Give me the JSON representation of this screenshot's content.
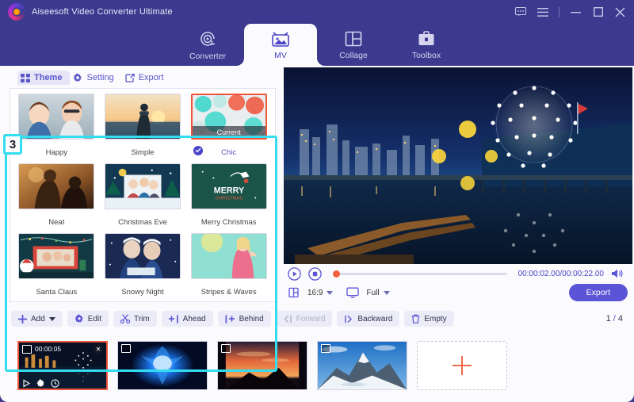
{
  "titlebar": {
    "app_title": "Aiseesoft Video Converter Ultimate",
    "controls": [
      {
        "name": "feedback-icon",
        "label": "Feedback"
      },
      {
        "name": "menu-icon",
        "label": "Menu"
      },
      {
        "name": "minimize-icon",
        "label": "Minimize"
      },
      {
        "name": "maximize-icon",
        "label": "Maximize"
      },
      {
        "name": "close-icon",
        "label": "Close"
      }
    ]
  },
  "nav": {
    "tabs": [
      {
        "label": "Converter",
        "active": false
      },
      {
        "label": "MV",
        "active": true
      },
      {
        "label": "Collage",
        "active": false
      },
      {
        "label": "Toolbox",
        "active": false
      }
    ]
  },
  "subtabs": [
    {
      "label": "Theme",
      "active": true
    },
    {
      "label": "Setting",
      "active": false
    },
    {
      "label": "Export",
      "active": false
    }
  ],
  "annotation": {
    "step_number": "3",
    "highlight_color": "#33dcef"
  },
  "themes": [
    {
      "name": "Happy",
      "selected": false
    },
    {
      "name": "Simple",
      "selected": false
    },
    {
      "name": "Chic",
      "selected": true,
      "badge": "Current"
    },
    {
      "name": "Neat",
      "selected": false
    },
    {
      "name": "Christmas Eve",
      "selected": false
    },
    {
      "name": "Merry Christmas",
      "selected": false
    },
    {
      "name": "Santa Claus",
      "selected": false
    },
    {
      "name": "Snowy Night",
      "selected": false
    },
    {
      "name": "Stripes & Waves",
      "selected": false
    }
  ],
  "player": {
    "timecode_current": "00:00:02.00",
    "timecode_total": "00:00:22.00",
    "timecode_display": "00:00:02.00/00:00:22.00",
    "progress_percent": 9,
    "aspect_ratio": "16:9",
    "quality": "Full",
    "export_label": "Export"
  },
  "toolbar": {
    "buttons": [
      {
        "label": "Add",
        "icon": "plus-icon",
        "dropdown": true,
        "disabled": false
      },
      {
        "label": "Edit",
        "icon": "edit-icon",
        "dropdown": false,
        "disabled": false
      },
      {
        "label": "Trim",
        "icon": "scissors-icon",
        "dropdown": false,
        "disabled": false
      },
      {
        "label": "Ahead",
        "icon": "insert-ahead-icon",
        "dropdown": false,
        "disabled": false
      },
      {
        "label": "Behind",
        "icon": "insert-behind-icon",
        "dropdown": false,
        "disabled": false
      },
      {
        "label": "Forward",
        "icon": "move-forward-icon",
        "dropdown": false,
        "disabled": true
      },
      {
        "label": "Backward",
        "icon": "move-backward-icon",
        "dropdown": false,
        "disabled": false
      },
      {
        "label": "Empty",
        "icon": "trash-icon",
        "dropdown": false,
        "disabled": false
      }
    ],
    "page_current": "1",
    "page_separator": "/",
    "page_total": "4"
  },
  "clips": [
    {
      "duration": "00:00:05",
      "selected": true,
      "has_close": true
    },
    {
      "duration": "",
      "selected": false,
      "has_close": false
    },
    {
      "duration": "",
      "selected": false,
      "has_close": false
    },
    {
      "duration": "",
      "selected": false,
      "has_close": false
    }
  ],
  "add_clip": {
    "label": "+"
  },
  "colors": {
    "header_purple": "#3b3a8f",
    "accent_purple": "#5b54d6",
    "selection_orange": "#f0543c",
    "highlight_cyan": "#33dcef"
  }
}
